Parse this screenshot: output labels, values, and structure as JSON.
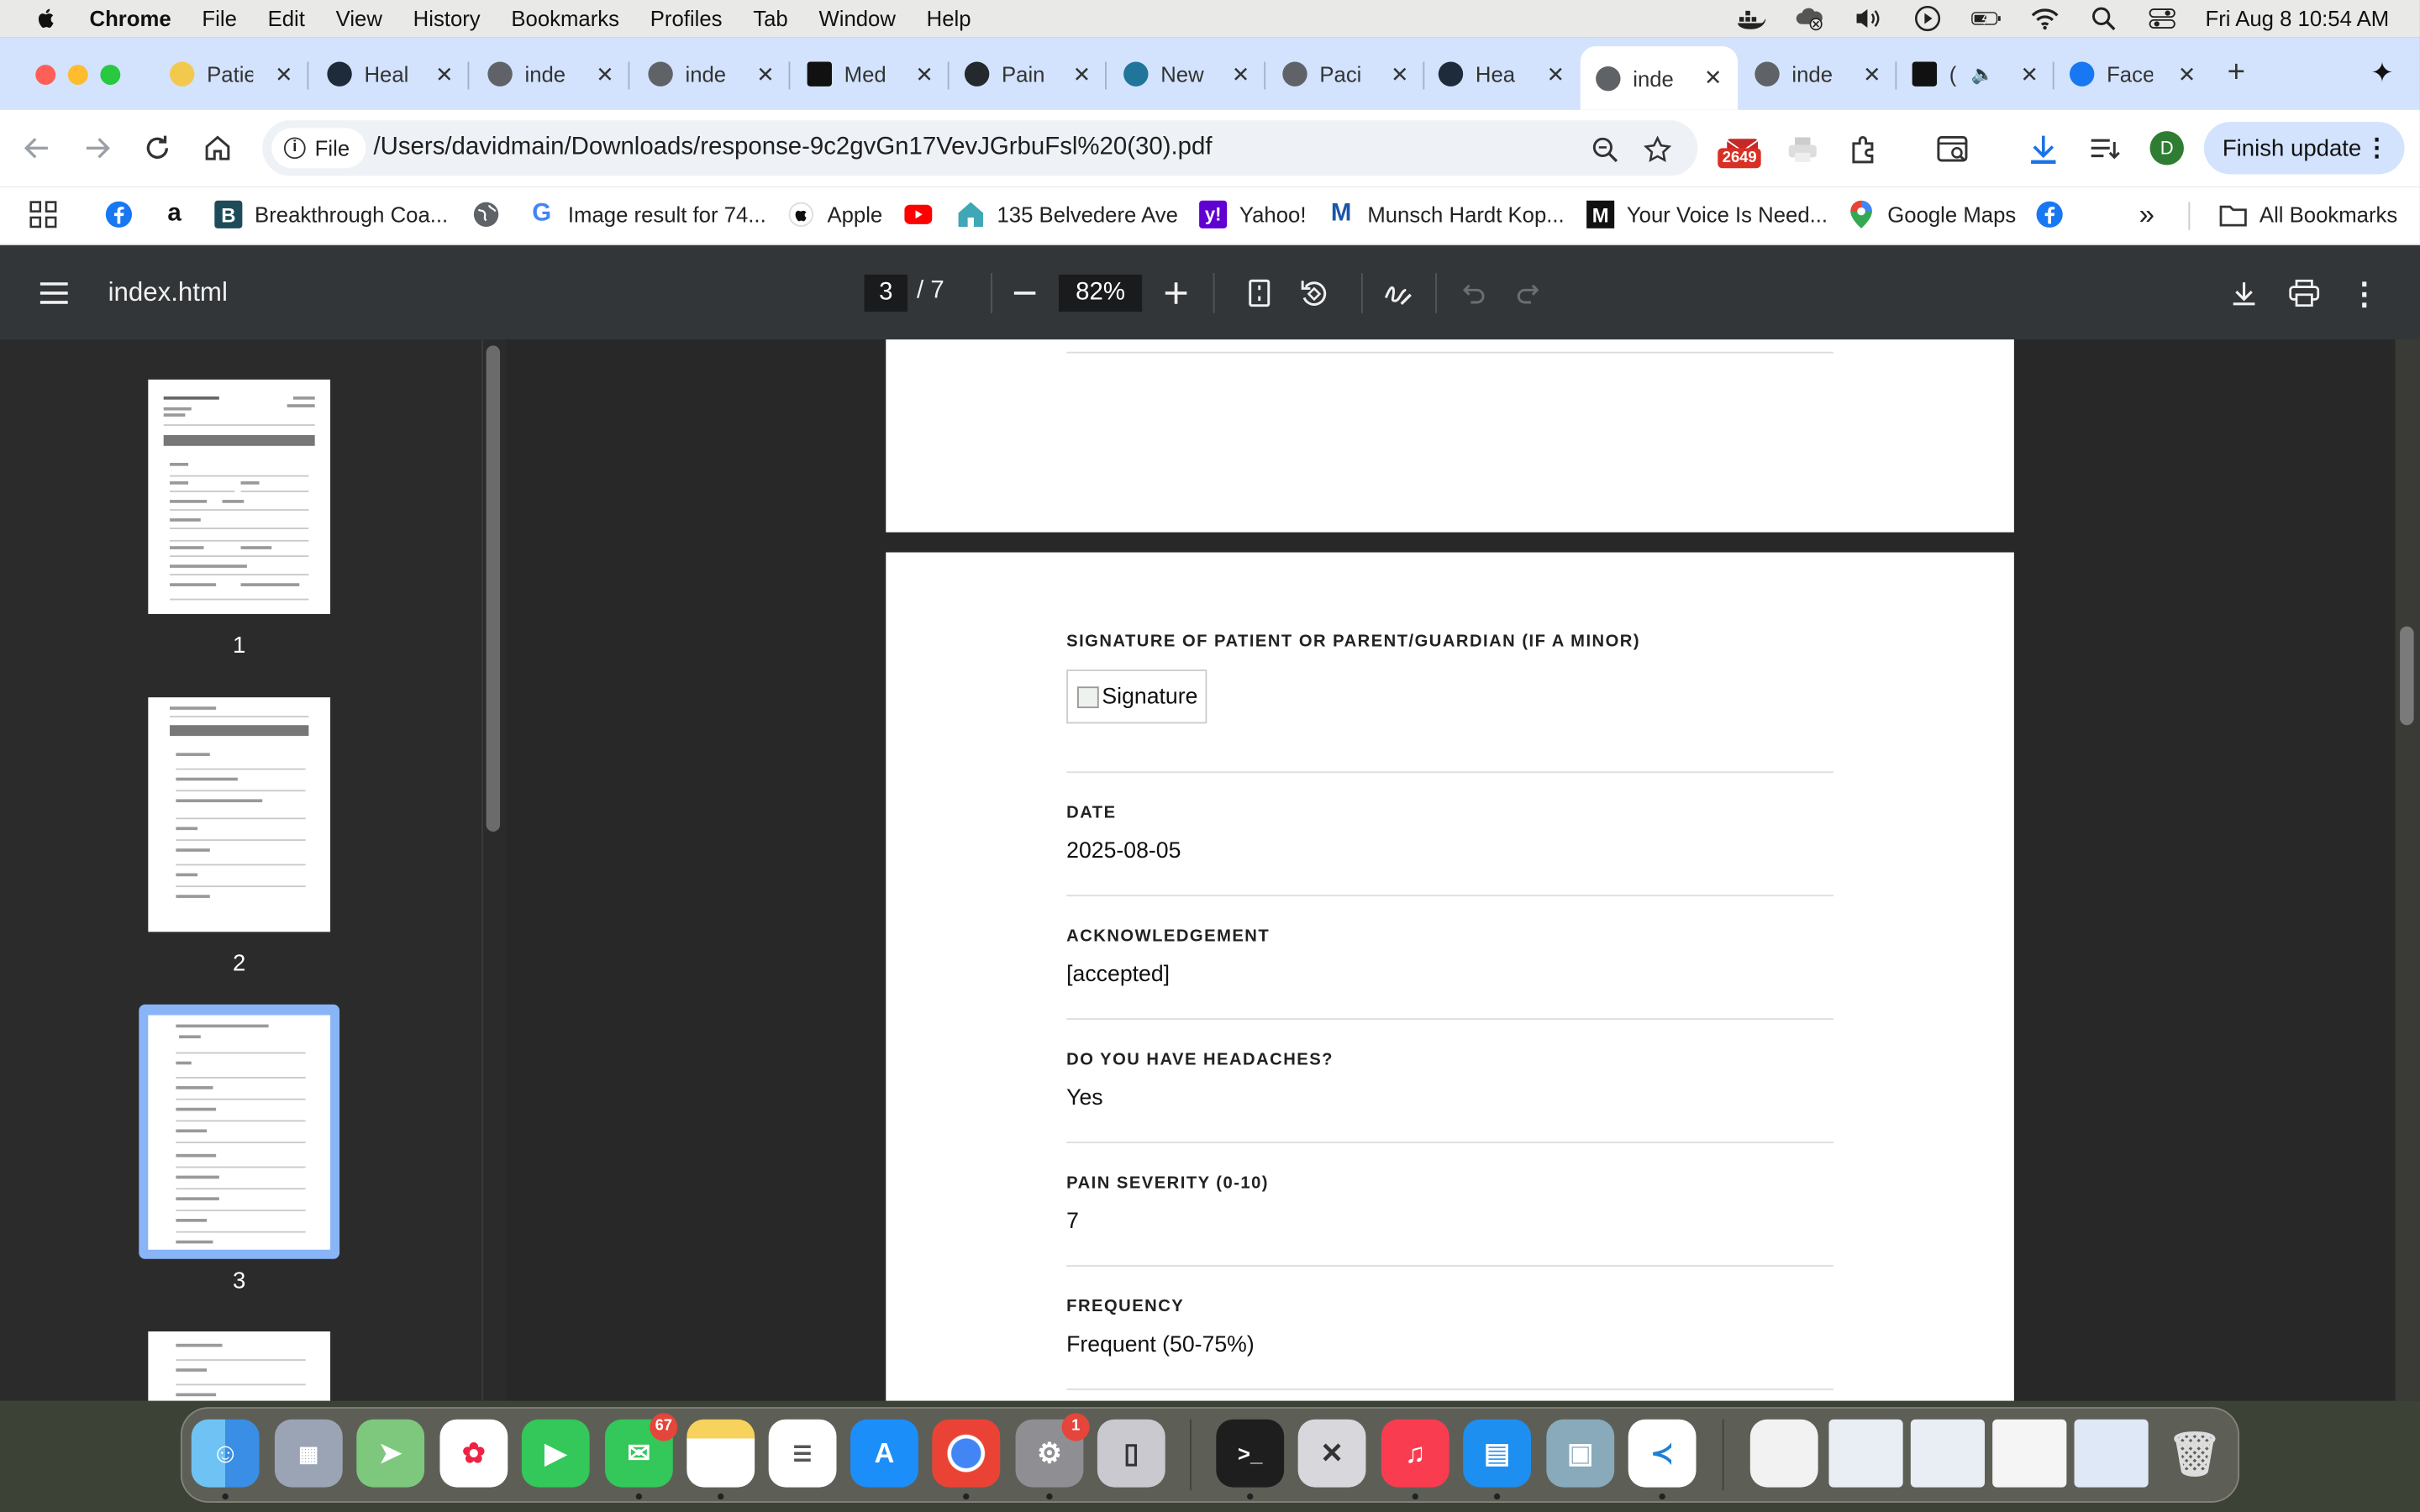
{
  "menubar": {
    "app_name": "Chrome",
    "menus": [
      "File",
      "Edit",
      "View",
      "History",
      "Bookmarks",
      "Profiles",
      "Tab",
      "Window",
      "Help"
    ],
    "clock": "Fri Aug 8  10:54 AM"
  },
  "tabs": [
    {
      "title": "Patie",
      "icon": "chatgpt-icon",
      "color": "#f2c94c"
    },
    {
      "title": "Heal",
      "icon": "react-icon",
      "color": "#1e2b3a"
    },
    {
      "title": "inde",
      "icon": "globe-icon",
      "color": "#5f6368"
    },
    {
      "title": "inde",
      "icon": "globe-icon",
      "color": "#5f6368"
    },
    {
      "title": "Med",
      "icon": "medium-icon",
      "color": "#111111"
    },
    {
      "title": "Pain",
      "icon": "github-icon",
      "color": "#24292e"
    },
    {
      "title": "New",
      "icon": "wordpress-icon",
      "color": "#21759b"
    },
    {
      "title": "Paci",
      "icon": "globe-icon",
      "color": "#5f6368"
    },
    {
      "title": "Hea",
      "icon": "react-icon",
      "color": "#1e2b3a"
    },
    {
      "title": "inde",
      "icon": "globe-icon",
      "color": "#5f6368",
      "active": true
    },
    {
      "title": "inde",
      "icon": "globe-icon",
      "color": "#5f6368"
    },
    {
      "title": "(",
      "icon": "x-icon",
      "color": "#111111"
    },
    {
      "title": "Face",
      "icon": "facebook-icon",
      "color": "#1877f2"
    }
  ],
  "toolbar": {
    "chip_label": "File",
    "url": "/Users/davidmain/Downloads/response-9c2gvGn17VevJGrbuFsl%20(30).pdf",
    "ext_badge": "2649",
    "avatar_letter": "D",
    "finish_update": "Finish update"
  },
  "bookmarks": [
    {
      "label": "",
      "icon": "facebook-icon"
    },
    {
      "label": "",
      "icon": "amazon-icon"
    },
    {
      "label": "Breakthrough Coa...",
      "icon": "b-icon"
    },
    {
      "label": "",
      "icon": "globe-icon"
    },
    {
      "label": "Image result for 74...",
      "icon": "google-icon"
    },
    {
      "label": "Apple",
      "icon": "apple-icon"
    },
    {
      "label": "",
      "icon": "youtube-icon"
    },
    {
      "label": "135 Belvedere Ave",
      "icon": "house-icon"
    },
    {
      "label": "Yahoo!",
      "icon": "yahoo-icon"
    },
    {
      "label": "Munsch Hardt Kop...",
      "icon": "m-icon"
    },
    {
      "label": "Your Voice Is Need...",
      "icon": "medium-icon"
    },
    {
      "label": "Google Maps",
      "icon": "maps-pin-icon"
    },
    {
      "label": "",
      "icon": "facebook-icon"
    }
  ],
  "all_bookmarks": "All Bookmarks",
  "pdf": {
    "title": "index.html",
    "current_page": "3",
    "page_total": "/  7",
    "zoom": "82%",
    "thumbnails": [
      "1",
      "2",
      "3"
    ],
    "selected_thumbnail": "3",
    "fields": [
      {
        "label": "SIGNATURE OF PATIENT OR PARENT/GUARDIAN (IF A MINOR)",
        "value": "Signature",
        "type": "image"
      },
      {
        "label": "DATE",
        "value": "2025-08-05"
      },
      {
        "label": "ACKNOWLEDGEMENT",
        "value": "[accepted]"
      },
      {
        "label": "DO YOU HAVE HEADACHES?",
        "value": "Yes"
      },
      {
        "label": "PAIN SEVERITY (0-10)",
        "value": "7"
      },
      {
        "label": "FREQUENCY",
        "value": "Frequent (50-75%)"
      }
    ]
  },
  "dock": {
    "messages_badge": "67",
    "settings_badge": "1"
  }
}
